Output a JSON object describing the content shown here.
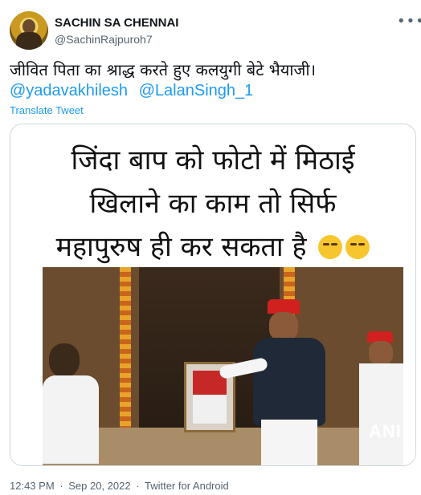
{
  "header": {
    "display_name": "SACHIN SA CHENNAI",
    "handle": "@SachinRajpuroh7",
    "more_icon": "ellipsis-icon"
  },
  "tweet": {
    "text": "जीवित पिता का श्राद्ध करते हुए कलयुगी बेटे भैयाजी।",
    "mentions": [
      "@yadavakhilesh",
      "@LalanSingh_1"
    ],
    "translate_label": "Translate Tweet"
  },
  "media": {
    "caption_lines": [
      "जिंदा बाप को फोटो में मिठाई",
      "खिलाने का काम तो सिर्फ",
      "महापुरुष ही कर सकता है"
    ],
    "emoji": [
      "😂",
      "😂"
    ],
    "watermark": "ANI"
  },
  "footer": {
    "time": "12:43 PM",
    "separator": "·",
    "date": "Sep 20, 2022",
    "source": "Twitter for Android"
  }
}
